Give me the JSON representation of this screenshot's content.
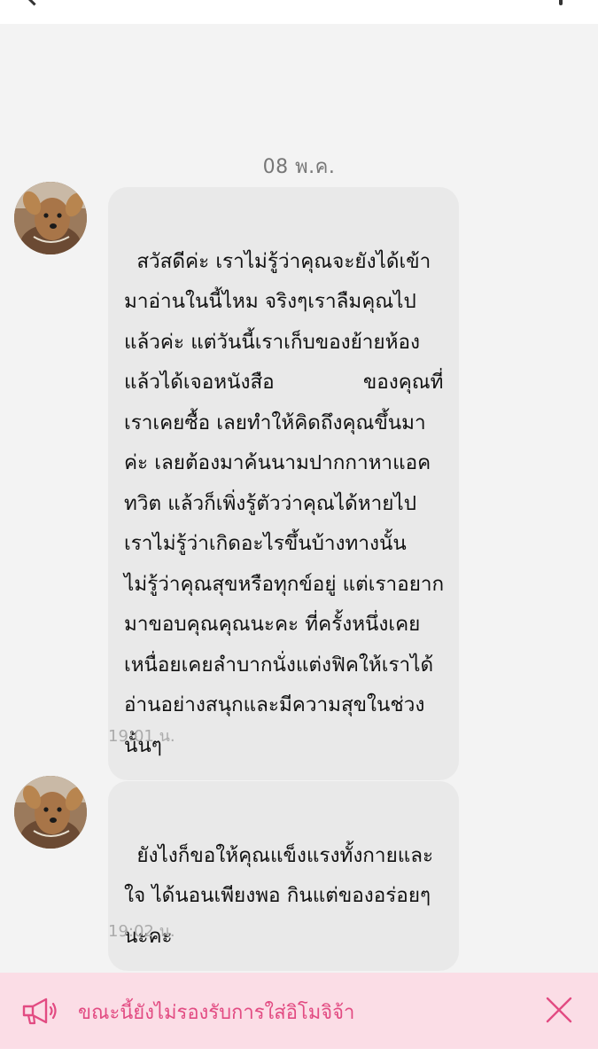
{
  "chat": {
    "date_separator": "08 พ.ค.",
    "messages": [
      {
        "text": "สวัสดีค่ะ เราไม่รู้ว่าคุณจะยังได้เข้ามาอ่านในนี้ไหม จริงๆเราลืมคุณไปแล้วค่ะ แต่วันนี้เราเก็บของย้ายห้องแล้วได้เจอหนังสือ              ของคุณที่เราเคยซื้อ เลยทำให้คิดถึงคุณขึ้นมาค่ะ เลยต้องมาค้นนามปากกาหาแอคทวิต แล้วก็เพิ่งรู้ตัวว่าคุณได้หายไป เราไม่รู้ว่าเกิดอะไรขึ้นบ้างทางนั้น ไม่รู้ว่าคุณสุขหรือทุกข์อยู่ แต่เราอยากมาขอบคุณคุณนะคะ ที่ครั้งหนึ่งเคยเหนื่อยเคยลำบากนั่งแต่งฟิคให้เราได้อ่านอย่างสนุกและมีความสุขในช่วงนั้นๆ",
        "time": "19:01 น."
      },
      {
        "text": "ยังไงก็ขอให้คุณแข็งแรงทั้งกายและใจ ได้นอนเพียงพอ กินแต่ของอร่อยๆนะคะ",
        "time": "19:02 น."
      }
    ]
  },
  "banner": {
    "text": "ขณะนี้ยังไม่รองรับการใส่อิโมจิจ้า",
    "icon": "megaphone-icon",
    "close_icon": "close-icon",
    "color": "#e24b82",
    "background": "#fbdde6"
  },
  "colors": {
    "background": "#f3f3f3",
    "bubble": "#e9e9e9"
  }
}
